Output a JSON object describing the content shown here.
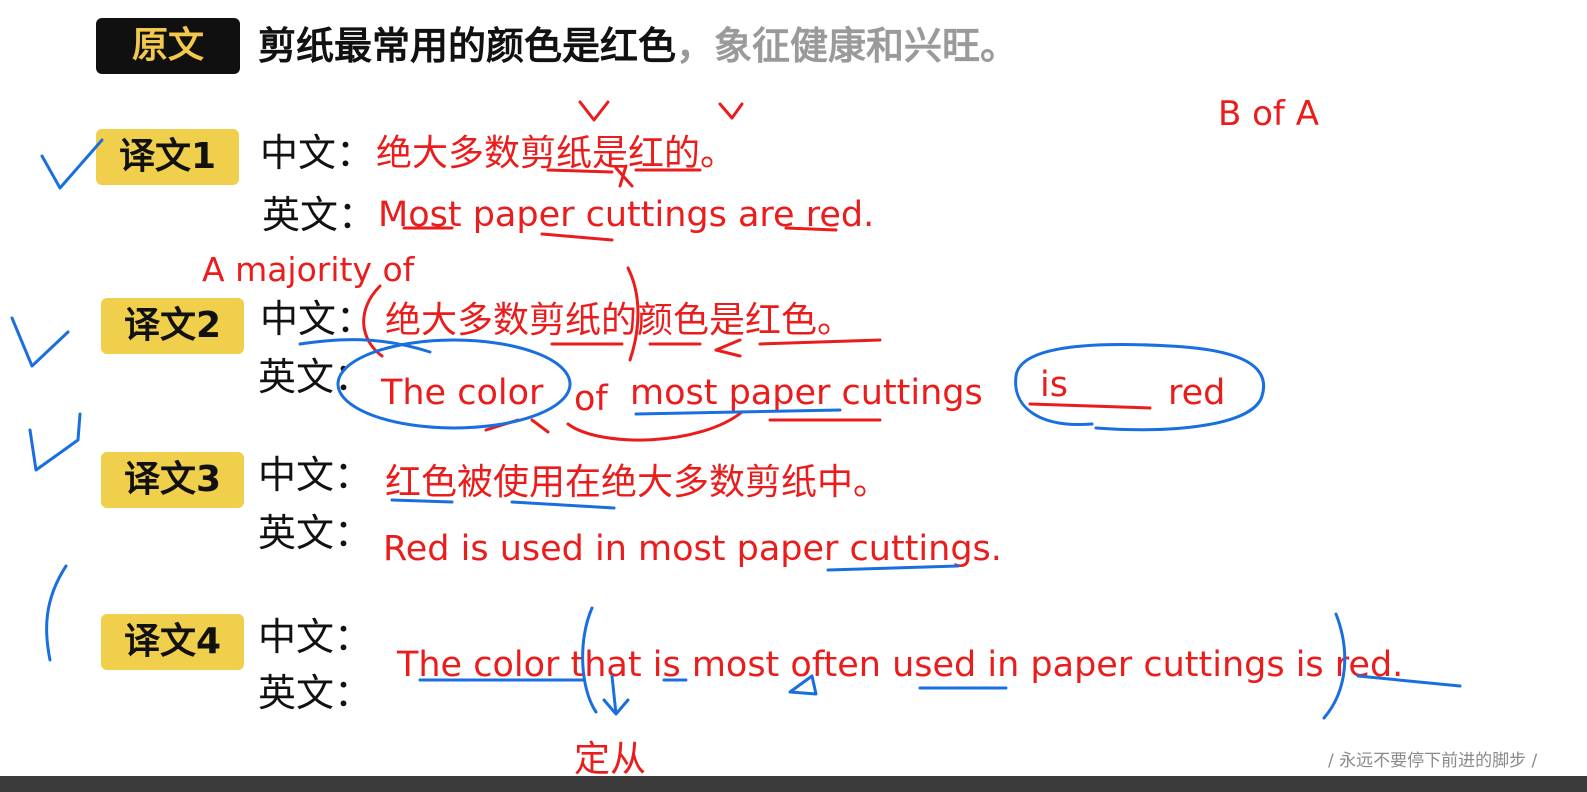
{
  "source": {
    "badge": "原文",
    "main": "剪纸最常用的颜色是红色",
    "rest": "，象征健康和兴旺。"
  },
  "labels": {
    "zh": "中文：",
    "en": "英文："
  },
  "translations": [
    {
      "badge": "译文1",
      "zh": "绝大多数剪纸是红的。",
      "en": "Most paper cuttings are red."
    },
    {
      "badge": "译文2",
      "zh": "绝大多数剪纸的颜色是红色。",
      "en_parts": [
        "The color",
        "of",
        "most paper cuttings",
        "is",
        "red"
      ]
    },
    {
      "badge": "译文3",
      "zh": "红色被使用在绝大多数剪纸中。",
      "en": "Red is used in most paper cuttings."
    },
    {
      "badge": "译文4",
      "zh": "",
      "en": "The color that is most often used  in paper cuttings is red."
    }
  ],
  "annotations": {
    "b_of_a": "B of A",
    "a_majority_of": "A majority of",
    "dingcong": "定从"
  },
  "footer": "/ 永远不要停下前进的脚步 /",
  "colors": {
    "ink_red": "#ea1c1c",
    "ink_blue": "#1a6fe0",
    "badge_yellow": "#f0cf4c",
    "badge_black": "#101010"
  }
}
